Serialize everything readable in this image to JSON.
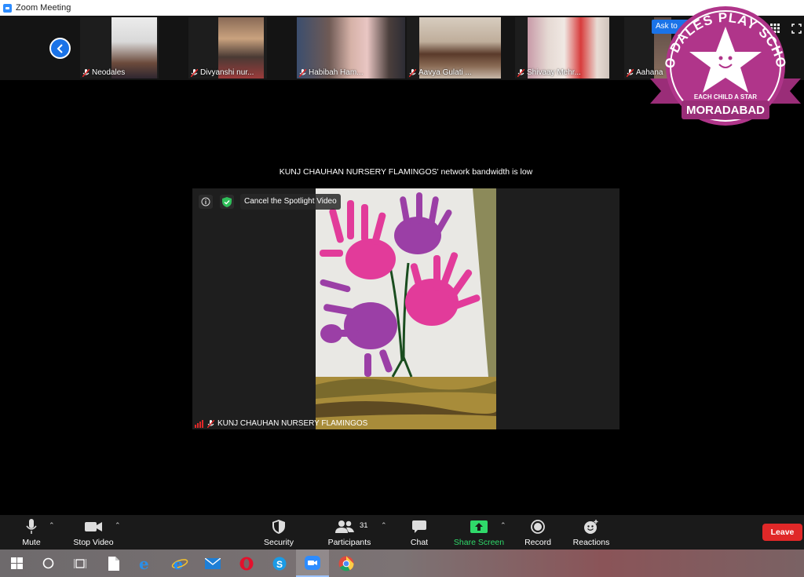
{
  "window": {
    "title": "Zoom Meeting"
  },
  "strip": {
    "participants": [
      {
        "name": "Neodales"
      },
      {
        "name": "Divyanshi nur..."
      },
      {
        "name": "Habibah Ham..."
      },
      {
        "name": "Aavya Gulati ..."
      },
      {
        "name": "Shivaay Mehr..."
      },
      {
        "name": "Aahana"
      }
    ],
    "ask_label": "Ask to"
  },
  "banner": {
    "bandwidth_text": "KUNJ CHAUHAN NURSERY FLAMINGOS' network bandwidth is low"
  },
  "spotlight": {
    "cancel_label": "Cancel the Spotlight Video",
    "name": "KUNJ CHAUHAN NURSERY FLAMINGOS"
  },
  "logo": {
    "top_text": "NEO DALES PLAY SCHOOL",
    "tagline": "EACH CHILD A STAR",
    "city": "MORADABAD",
    "colors": {
      "badge": "#b0358a",
      "ribbon": "#9a2d78"
    }
  },
  "toolbar": {
    "mute": "Mute",
    "stop_video": "Stop Video",
    "security": "Security",
    "participants": "Participants",
    "participant_count": "31",
    "chat": "Chat",
    "share_screen": "Share Screen",
    "record": "Record",
    "reactions": "Reactions",
    "leave": "Leave",
    "share_color": "#2fd96a",
    "leave_color": "#e02828"
  },
  "taskbar": {
    "icons": [
      "windows-start-icon",
      "search-circle-icon",
      "task-view-icon",
      "file-icon",
      "edge-icon",
      "internet-explorer-icon",
      "mail-icon",
      "opera-icon",
      "skype-icon",
      "zoom-icon",
      "chrome-icon"
    ]
  }
}
